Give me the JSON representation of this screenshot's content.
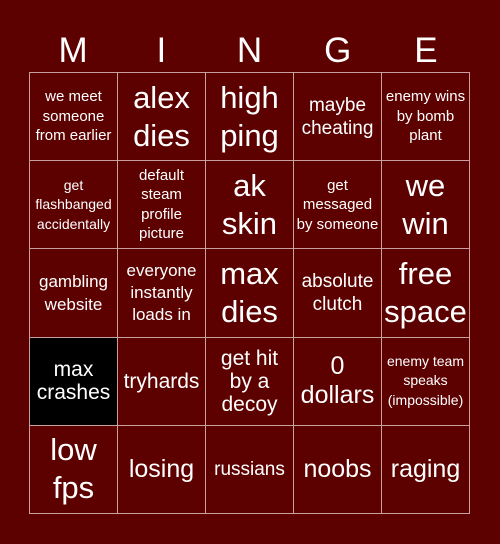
{
  "title_letters": [
    "M",
    "I",
    "N",
    "G",
    "E"
  ],
  "colors": {
    "background": "#5c0000",
    "grid_line": "#c8a0a0",
    "marked_cell": "#000000",
    "text": "#ffffff"
  },
  "cells": [
    {
      "text": "we meet someone from earlier",
      "marked": false
    },
    {
      "text": "alex dies",
      "marked": false
    },
    {
      "text": "high ping",
      "marked": false
    },
    {
      "text": "maybe cheating",
      "marked": false
    },
    {
      "text": "enemy wins by bomb plant",
      "marked": false
    },
    {
      "text": "get flashbanged accidentally",
      "marked": false
    },
    {
      "text": "default steam profile picture",
      "marked": false
    },
    {
      "text": "ak skin",
      "marked": false
    },
    {
      "text": "get messaged by someone",
      "marked": false
    },
    {
      "text": "we win",
      "marked": false
    },
    {
      "text": "gambling website",
      "marked": false
    },
    {
      "text": "everyone instantly loads in",
      "marked": false
    },
    {
      "text": "max dies",
      "marked": false
    },
    {
      "text": "absolute clutch",
      "marked": false
    },
    {
      "text": "free space",
      "marked": false
    },
    {
      "text": "max crashes",
      "marked": true
    },
    {
      "text": "tryhards",
      "marked": false
    },
    {
      "text": "get hit by a decoy",
      "marked": false
    },
    {
      "text": "0 dollars",
      "marked": false
    },
    {
      "text": "enemy team speaks (impossible)",
      "marked": false
    },
    {
      "text": "low fps",
      "marked": false
    },
    {
      "text": "losing",
      "marked": false
    },
    {
      "text": "russians",
      "marked": false
    },
    {
      "text": "noobs",
      "marked": false
    },
    {
      "text": "raging",
      "marked": false
    }
  ]
}
